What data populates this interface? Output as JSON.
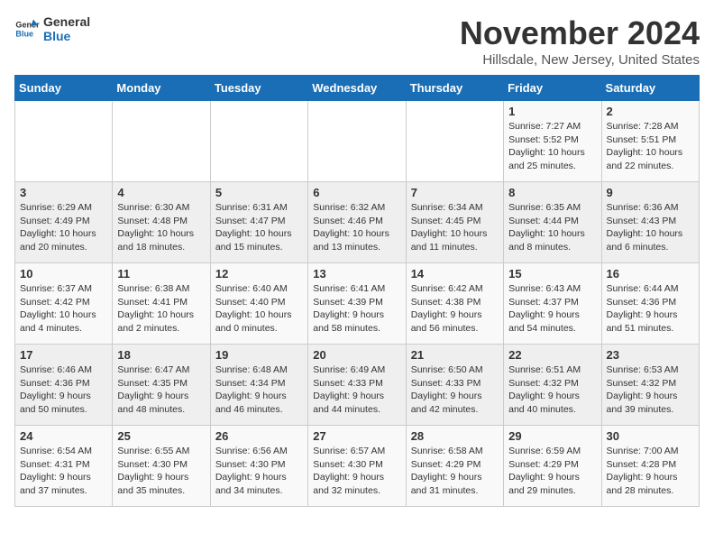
{
  "logo": {
    "line1": "General",
    "line2": "Blue"
  },
  "title": "November 2024",
  "location": "Hillsdale, New Jersey, United States",
  "days_of_week": [
    "Sunday",
    "Monday",
    "Tuesday",
    "Wednesday",
    "Thursday",
    "Friday",
    "Saturday"
  ],
  "weeks": [
    [
      {
        "day": "",
        "info": ""
      },
      {
        "day": "",
        "info": ""
      },
      {
        "day": "",
        "info": ""
      },
      {
        "day": "",
        "info": ""
      },
      {
        "day": "",
        "info": ""
      },
      {
        "day": "1",
        "info": "Sunrise: 7:27 AM\nSunset: 5:52 PM\nDaylight: 10 hours and 25 minutes."
      },
      {
        "day": "2",
        "info": "Sunrise: 7:28 AM\nSunset: 5:51 PM\nDaylight: 10 hours and 22 minutes."
      }
    ],
    [
      {
        "day": "3",
        "info": "Sunrise: 6:29 AM\nSunset: 4:49 PM\nDaylight: 10 hours and 20 minutes."
      },
      {
        "day": "4",
        "info": "Sunrise: 6:30 AM\nSunset: 4:48 PM\nDaylight: 10 hours and 18 minutes."
      },
      {
        "day": "5",
        "info": "Sunrise: 6:31 AM\nSunset: 4:47 PM\nDaylight: 10 hours and 15 minutes."
      },
      {
        "day": "6",
        "info": "Sunrise: 6:32 AM\nSunset: 4:46 PM\nDaylight: 10 hours and 13 minutes."
      },
      {
        "day": "7",
        "info": "Sunrise: 6:34 AM\nSunset: 4:45 PM\nDaylight: 10 hours and 11 minutes."
      },
      {
        "day": "8",
        "info": "Sunrise: 6:35 AM\nSunset: 4:44 PM\nDaylight: 10 hours and 8 minutes."
      },
      {
        "day": "9",
        "info": "Sunrise: 6:36 AM\nSunset: 4:43 PM\nDaylight: 10 hours and 6 minutes."
      }
    ],
    [
      {
        "day": "10",
        "info": "Sunrise: 6:37 AM\nSunset: 4:42 PM\nDaylight: 10 hours and 4 minutes."
      },
      {
        "day": "11",
        "info": "Sunrise: 6:38 AM\nSunset: 4:41 PM\nDaylight: 10 hours and 2 minutes."
      },
      {
        "day": "12",
        "info": "Sunrise: 6:40 AM\nSunset: 4:40 PM\nDaylight: 10 hours and 0 minutes."
      },
      {
        "day": "13",
        "info": "Sunrise: 6:41 AM\nSunset: 4:39 PM\nDaylight: 9 hours and 58 minutes."
      },
      {
        "day": "14",
        "info": "Sunrise: 6:42 AM\nSunset: 4:38 PM\nDaylight: 9 hours and 56 minutes."
      },
      {
        "day": "15",
        "info": "Sunrise: 6:43 AM\nSunset: 4:37 PM\nDaylight: 9 hours and 54 minutes."
      },
      {
        "day": "16",
        "info": "Sunrise: 6:44 AM\nSunset: 4:36 PM\nDaylight: 9 hours and 51 minutes."
      }
    ],
    [
      {
        "day": "17",
        "info": "Sunrise: 6:46 AM\nSunset: 4:36 PM\nDaylight: 9 hours and 50 minutes."
      },
      {
        "day": "18",
        "info": "Sunrise: 6:47 AM\nSunset: 4:35 PM\nDaylight: 9 hours and 48 minutes."
      },
      {
        "day": "19",
        "info": "Sunrise: 6:48 AM\nSunset: 4:34 PM\nDaylight: 9 hours and 46 minutes."
      },
      {
        "day": "20",
        "info": "Sunrise: 6:49 AM\nSunset: 4:33 PM\nDaylight: 9 hours and 44 minutes."
      },
      {
        "day": "21",
        "info": "Sunrise: 6:50 AM\nSunset: 4:33 PM\nDaylight: 9 hours and 42 minutes."
      },
      {
        "day": "22",
        "info": "Sunrise: 6:51 AM\nSunset: 4:32 PM\nDaylight: 9 hours and 40 minutes."
      },
      {
        "day": "23",
        "info": "Sunrise: 6:53 AM\nSunset: 4:32 PM\nDaylight: 9 hours and 39 minutes."
      }
    ],
    [
      {
        "day": "24",
        "info": "Sunrise: 6:54 AM\nSunset: 4:31 PM\nDaylight: 9 hours and 37 minutes."
      },
      {
        "day": "25",
        "info": "Sunrise: 6:55 AM\nSunset: 4:30 PM\nDaylight: 9 hours and 35 minutes."
      },
      {
        "day": "26",
        "info": "Sunrise: 6:56 AM\nSunset: 4:30 PM\nDaylight: 9 hours and 34 minutes."
      },
      {
        "day": "27",
        "info": "Sunrise: 6:57 AM\nSunset: 4:30 PM\nDaylight: 9 hours and 32 minutes."
      },
      {
        "day": "28",
        "info": "Sunrise: 6:58 AM\nSunset: 4:29 PM\nDaylight: 9 hours and 31 minutes."
      },
      {
        "day": "29",
        "info": "Sunrise: 6:59 AM\nSunset: 4:29 PM\nDaylight: 9 hours and 29 minutes."
      },
      {
        "day": "30",
        "info": "Sunrise: 7:00 AM\nSunset: 4:28 PM\nDaylight: 9 hours and 28 minutes."
      }
    ]
  ]
}
